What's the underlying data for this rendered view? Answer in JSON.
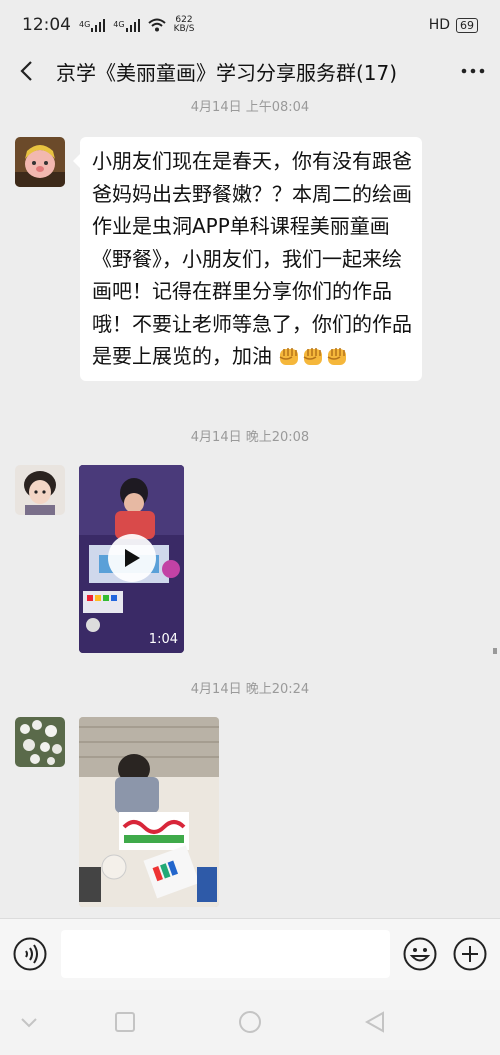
{
  "status_bar": {
    "time": "12:04",
    "signal1": "4G",
    "signal2": "4G",
    "net_speed_value": "622",
    "net_speed_unit": "KB/S",
    "hd_label": "HD",
    "battery": "69"
  },
  "chat": {
    "title": "京学《美丽童画》学习分享服务群(17)"
  },
  "messages": [
    {
      "timestamp": "4月14日 上午08:04",
      "type": "text",
      "text": "小朋友们现在是春天，你有没有跟爸爸妈妈出去野餐嫩？？本周二的绘画作业是虫洞APP单科课程美丽童画《野餐》，小朋友们，我们一起来绘画吧！记得在群里分享你们的作品哦！不要让老师等急了，你们的作品是要上展览的，加油"
    },
    {
      "timestamp": "4月14日 晚上20:08",
      "type": "video",
      "duration": "1:04"
    },
    {
      "timestamp": "4月14日 晚上20:24",
      "type": "image"
    }
  ],
  "icons": {
    "back": "chevron-left-icon",
    "more": "more-icon",
    "voice": "voice-icon",
    "emoji": "emoji-icon",
    "plus": "plus-icon",
    "fist": "fist-emoji",
    "play": "play-icon"
  },
  "colors": {
    "background": "#ededed",
    "bubble": "#ffffff",
    "timestamp": "#9a9a9a"
  }
}
